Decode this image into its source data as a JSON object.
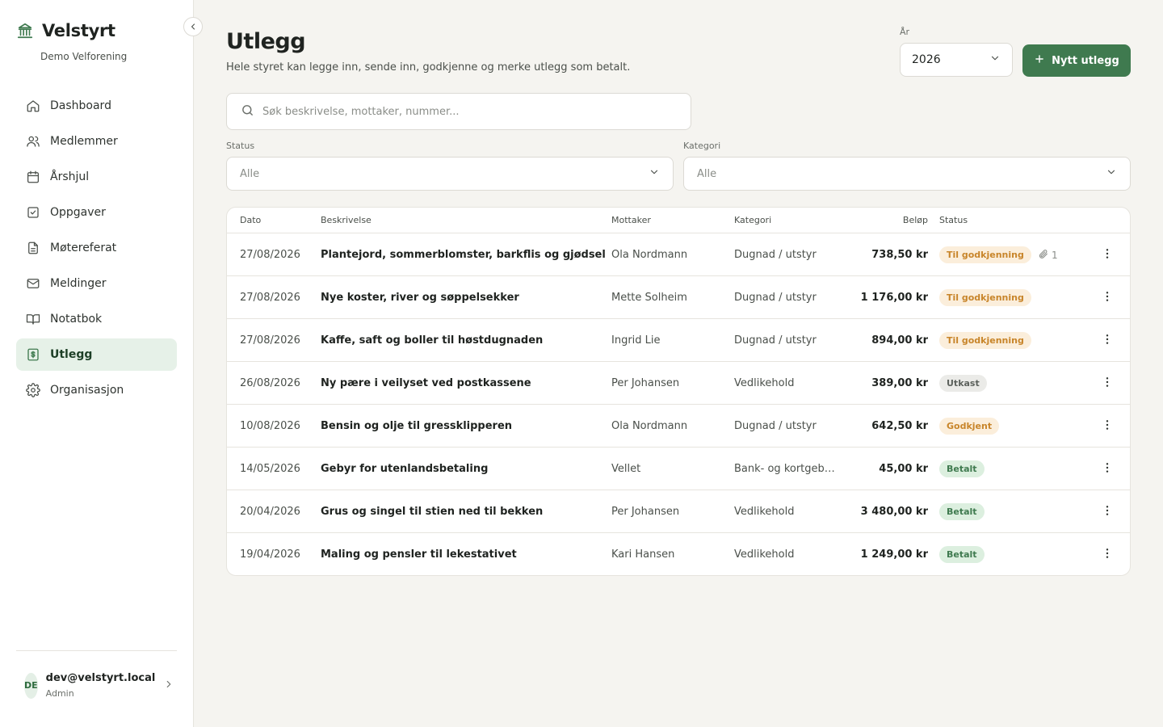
{
  "app": {
    "name": "Velstyrt",
    "org": "Demo Velforening"
  },
  "sidebar": {
    "items": [
      {
        "label": "Dashboard",
        "icon": "home-icon"
      },
      {
        "label": "Medlemmer",
        "icon": "users-icon"
      },
      {
        "label": "Årshjul",
        "icon": "calendar-icon"
      },
      {
        "label": "Oppgaver",
        "icon": "checkbox-icon"
      },
      {
        "label": "Møtereferat",
        "icon": "document-icon"
      },
      {
        "label": "Meldinger",
        "icon": "mail-icon"
      },
      {
        "label": "Notatbok",
        "icon": "book-icon"
      },
      {
        "label": "Utlegg",
        "icon": "receipt-icon",
        "active": true
      },
      {
        "label": "Organisasjon",
        "icon": "gear-icon"
      }
    ]
  },
  "user": {
    "initials": "DE",
    "email": "dev@velstyrt.local",
    "role": "Admin"
  },
  "header": {
    "title": "Utlegg",
    "subtitle": "Hele styret kan legge inn, sende inn, godkjenne og merke utlegg som betalt.",
    "year_label": "År",
    "year_value": "2026",
    "new_button": "Nytt utlegg"
  },
  "search": {
    "placeholder": "Søk beskrivelse, mottaker, nummer..."
  },
  "filters": {
    "status_label": "Status",
    "status_value": "Alle",
    "category_label": "Kategori",
    "category_value": "Alle"
  },
  "table": {
    "columns": {
      "date": "Dato",
      "description": "Beskrivelse",
      "recipient": "Mottaker",
      "category": "Kategori",
      "amount": "Beløp",
      "status": "Status"
    },
    "rows": [
      {
        "date": "27/08/2026",
        "description": "Plantejord, sommerblomster, barkflis og gjødsel",
        "recipient": "Ola Nordmann",
        "category": "Dugnad / utstyr",
        "amount": "738,50 kr",
        "status": "Til godkjenning",
        "status_kind": "pending",
        "attachments": "1"
      },
      {
        "date": "27/08/2026",
        "description": "Nye koster, river og søppelsekker",
        "recipient": "Mette Solheim",
        "category": "Dugnad / utstyr",
        "amount": "1 176,00 kr",
        "status": "Til godkjenning",
        "status_kind": "pending"
      },
      {
        "date": "27/08/2026",
        "description": "Kaffe, saft og boller til høstdugnaden",
        "recipient": "Ingrid Lie",
        "category": "Dugnad / utstyr",
        "amount": "894,00 kr",
        "status": "Til godkjenning",
        "status_kind": "pending"
      },
      {
        "date": "26/08/2026",
        "description": "Ny pære i veilyset ved postkassene",
        "recipient": "Per Johansen",
        "category": "Vedlikehold",
        "amount": "389,00 kr",
        "status": "Utkast",
        "status_kind": "draft"
      },
      {
        "date": "10/08/2026",
        "description": "Bensin og olje til gressklipperen",
        "recipient": "Ola Nordmann",
        "category": "Dugnad / utstyr",
        "amount": "642,50 kr",
        "status": "Godkjent",
        "status_kind": "approved"
      },
      {
        "date": "14/05/2026",
        "description": "Gebyr for utenlandsbetaling",
        "recipient": "Vellet",
        "category": "Bank- og kortgebyrer",
        "amount": "45,00 kr",
        "status": "Betalt",
        "status_kind": "paid"
      },
      {
        "date": "20/04/2026",
        "description": "Grus og singel til stien ned til bekken",
        "recipient": "Per Johansen",
        "category": "Vedlikehold",
        "amount": "3 480,00 kr",
        "status": "Betalt",
        "status_kind": "paid"
      },
      {
        "date": "19/04/2026",
        "description": "Maling og pensler til lekestativet",
        "recipient": "Kari Hansen",
        "category": "Vedlikehold",
        "amount": "1 249,00 kr",
        "status": "Betalt",
        "status_kind": "paid"
      }
    ]
  },
  "colors": {
    "accent": "#3f7a4f",
    "background": "#f5f4f0",
    "pending": "#c8852a",
    "paid": "#3f7a4f"
  }
}
